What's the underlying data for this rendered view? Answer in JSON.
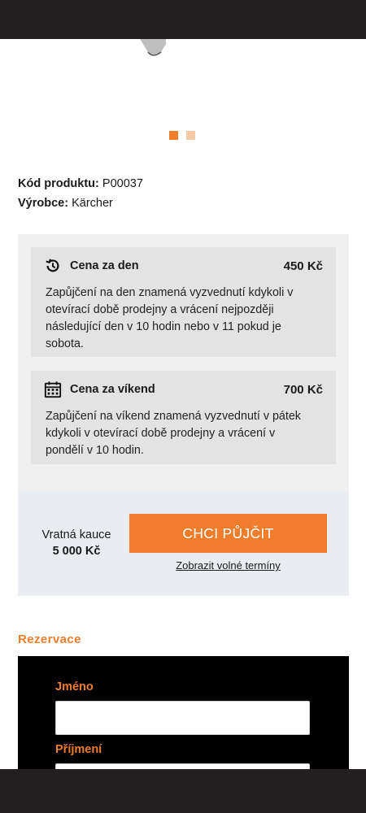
{
  "product": {
    "code_label": "Kód produktu:",
    "code_value": "P00037",
    "maker_label": "Výrobce:",
    "maker_value": "Kärcher"
  },
  "carousel": {
    "slides": 2,
    "active_index": 0
  },
  "pricing": {
    "day": {
      "icon": "history-clock-icon",
      "title": "Cena za den",
      "price": "450 Kč",
      "lines": [
        "Zapůjčení na den znamená vyzvednutí kdykoli v",
        "otevírací době prodejny a vrácení nejpozději",
        "následující den v 10 hodin nebo v 11 pokud je",
        "sobota."
      ]
    },
    "weekend": {
      "icon": "calendar-icon",
      "title": "Cena za víkend",
      "price": "700 Kč",
      "lines": [
        "Zapůjčení na víkend znamená vyzvednutí v pátek",
        "kdykoli v otevírací době prodejny a vrácení v",
        "pondělí v 10 hodin."
      ]
    }
  },
  "deposit": {
    "label": "Vratná kauce",
    "amount": "5 000 Kč"
  },
  "cta": {
    "label": "CHCI PŮJČIT",
    "link": "Zobrazit volné termíny"
  },
  "reservation": {
    "title": "Rezervace",
    "fields": [
      {
        "label": "Jméno",
        "value": ""
      },
      {
        "label": "Příjmení",
        "value": ""
      }
    ]
  },
  "colors": {
    "accent": "#f07d2c",
    "accent_light": "#f6c9a6",
    "bars": "#231f20"
  }
}
